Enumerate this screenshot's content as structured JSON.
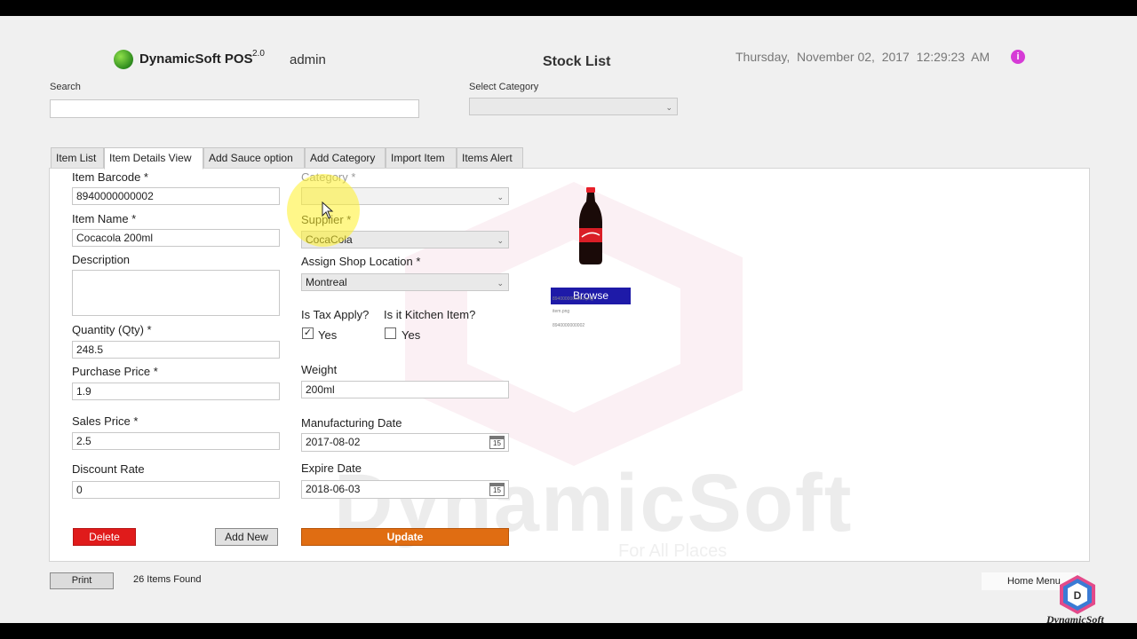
{
  "header": {
    "app_name": "DynamicSoft POS",
    "version": "2.0",
    "user": "admin",
    "title": "Stock List",
    "datetime": "Thursday,  November 02,  2017  12:29:23  AM"
  },
  "search": {
    "label": "Search",
    "value": ""
  },
  "select_category": {
    "label": "Select Category",
    "value": ""
  },
  "tabs": [
    {
      "label": "Item List"
    },
    {
      "label": "Item Details View",
      "active": true
    },
    {
      "label": "Add Sauce option"
    },
    {
      "label": "Add Category"
    },
    {
      "label": "Import Item"
    },
    {
      "label": "Items Alert"
    }
  ],
  "form": {
    "barcode": {
      "label": "Item Barcode *",
      "value": "8940000000002"
    },
    "item_name": {
      "label": "Item Name *",
      "value": "Cocacola 200ml"
    },
    "description": {
      "label": "Description",
      "value": ""
    },
    "quantity": {
      "label": "Quantity (Qty) *",
      "value": "248.5"
    },
    "purchase_price": {
      "label": "Purchase Price *",
      "value": "1.9"
    },
    "sales_price": {
      "label": "Sales Price *",
      "value": "2.5"
    },
    "discount_rate": {
      "label": "Discount Rate",
      "value": "0"
    },
    "category": {
      "label": "Category *",
      "value": ""
    },
    "supplier": {
      "label": "Supplier *",
      "value": "CocaCola"
    },
    "shop_location": {
      "label": "Assign Shop Location *",
      "value": "Montreal"
    },
    "tax": {
      "label": "Is Tax Apply?",
      "option": "Yes",
      "checked": true
    },
    "kitchen": {
      "label": "Is it Kitchen Item?",
      "option": "Yes",
      "checked": false
    },
    "weight": {
      "label": "Weight",
      "value": "200ml"
    },
    "manufacturing_date": {
      "label": "Manufacturing Date",
      "value": "2017-08-02"
    },
    "expire_date": {
      "label": "Expire Date",
      "value": "2018-06-03"
    },
    "calendar_day": "15"
  },
  "buttons": {
    "delete": "Delete",
    "add_new": "Add New",
    "update": "Update",
    "browse": "Browse",
    "print": "Print",
    "home_menu": "Home Menu"
  },
  "image_info": {
    "filename": "8940000000002.png",
    "meta": "item.png",
    "code": "8940000000002"
  },
  "watermark": {
    "text": "DynamicSoft",
    "sub": "For All Places"
  },
  "footer": {
    "items_found": "26 Items Found"
  },
  "corner_logo": {
    "letter": "D",
    "text": "DynamicSoft"
  },
  "colors": {
    "delete": "#e01b1b",
    "update": "#e06d12",
    "browse": "#1e1aa8",
    "info": "#d63bd6",
    "cursor_highlight": "#fff028"
  },
  "icons": [
    "logo-icon",
    "info-icon",
    "calendar-icon",
    "cursor-icon",
    "dropdown-arrow-icon"
  ]
}
